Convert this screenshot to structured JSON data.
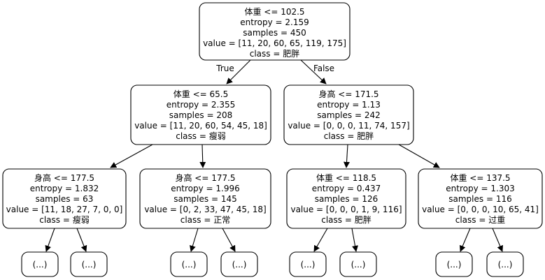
{
  "tree": {
    "nodes": {
      "root": {
        "lines": [
          "体重 <= 102.5",
          "entropy = 2.159",
          "samples = 450",
          "value = [11, 20, 60, 65, 119, 175]",
          "class = 肥胖"
        ]
      },
      "left": {
        "lines": [
          "体重 <= 65.5",
          "entropy = 2.355",
          "samples = 208",
          "value = [11, 20, 60, 54, 45, 18]",
          "class = 瘦弱"
        ]
      },
      "right": {
        "lines": [
          "身高 <= 171.5",
          "entropy = 1.13",
          "samples = 242",
          "value = [0, 0, 0, 11, 74, 157]",
          "class = 肥胖"
        ]
      },
      "ll": {
        "lines": [
          "身高 <= 177.5",
          "entropy = 1.832",
          "samples = 63",
          "value = [11, 18, 27, 7, 0, 0]",
          "class = 瘦弱"
        ]
      },
      "lr": {
        "lines": [
          "身高 <= 177.5",
          "entropy = 1.996",
          "samples = 145",
          "value = [0, 2, 33, 47, 45, 18]",
          "class = 正常"
        ]
      },
      "rl": {
        "lines": [
          "体重 <= 118.5",
          "entropy = 0.437",
          "samples = 126",
          "value = [0, 0, 0, 1, 9, 116]",
          "class = 肥胖"
        ]
      },
      "rr": {
        "lines": [
          "体重 <= 137.5",
          "entropy = 1.303",
          "samples = 116",
          "value = [0, 0, 0, 10, 65, 41]",
          "class = 过重"
        ]
      }
    },
    "ellipsis_label": "(...)",
    "true_label": "True",
    "false_label": "False"
  }
}
